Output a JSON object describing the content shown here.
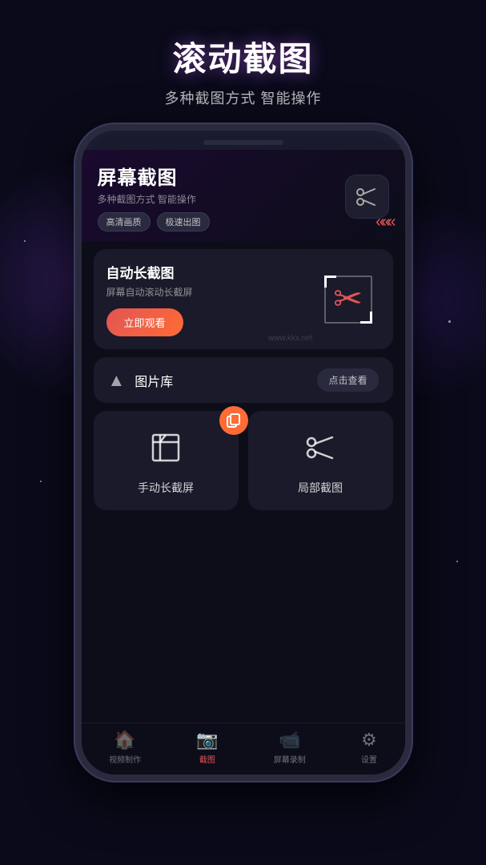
{
  "page": {
    "bg_color": "#0a0a1a",
    "title": "滚动截图",
    "subtitle": "多种截图方式 智能操作"
  },
  "phone": {
    "app_title": "屏幕截图",
    "app_subtitle": "多种截图方式 智能操作",
    "tag1": "高清画质",
    "tag2": "极速出图",
    "auto_section": {
      "title": "自动长截图",
      "desc": "屏幕自动滚动长截屏",
      "btn_label": "立即观看"
    },
    "gallery_section": {
      "label": "图片库",
      "btn_label": "点击查看"
    },
    "grid_items": [
      {
        "label": "手动长截屏",
        "icon": "crop"
      },
      {
        "label": "局部截图",
        "icon": "scissors"
      }
    ],
    "nav_items": [
      {
        "label": "视频制作",
        "icon": "🏠",
        "active": false
      },
      {
        "label": "截图",
        "icon": "📷",
        "active": true
      },
      {
        "label": "屏幕录制",
        "icon": "📹",
        "active": false
      },
      {
        "label": "设置",
        "icon": "⚙",
        "active": false
      }
    ],
    "watermark": "www.kkx.net"
  }
}
